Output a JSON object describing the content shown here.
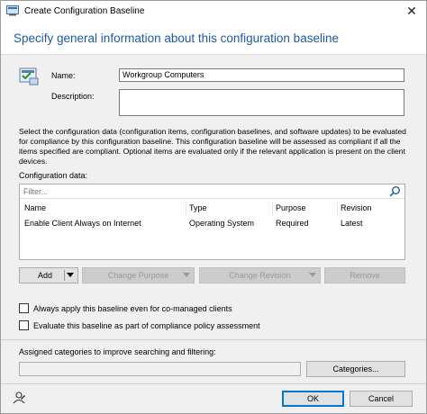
{
  "window": {
    "title": "Create Configuration Baseline",
    "close_glyph": "✕"
  },
  "header": {
    "heading": "Specify general information about this configuration baseline"
  },
  "form": {
    "name_label": "Name:",
    "name_value": "Workgroup Computers",
    "description_label": "Description:",
    "description_value": ""
  },
  "info_text": "Select the configuration data (configuration items, configuration baselines, and software updates) to be evaluated for compliance by this configuration baseline. This configuration baseline will be assessed as compliant if all the items specified are compliant. Optional items are evaluated only if the relevant application is present on  the client devices.",
  "config_data": {
    "label": "Configuration data:",
    "filter_placeholder": "Filter...",
    "columns": [
      "Name",
      "Type",
      "Purpose",
      "Revision"
    ],
    "rows": [
      {
        "name": "Enable Client Always on Internet",
        "type": "Operating System",
        "purpose": "Required",
        "revision": "Latest"
      }
    ]
  },
  "actions": {
    "add": "Add",
    "change_purpose": "Change Purpose",
    "change_revision": "Change Revision",
    "remove": "Remove"
  },
  "options": {
    "co_managed": "Always apply this baseline even for co-managed clients",
    "compliance_policy": "Evaluate this baseline as part of compliance policy assessment"
  },
  "categories": {
    "label": "Assigned categories to improve searching and filtering:",
    "value": "",
    "button": "Categories..."
  },
  "footer": {
    "ok": "OK",
    "cancel": "Cancel"
  },
  "colors": {
    "heading_blue": "#1e5aa8",
    "ok_border": "#0078d7"
  },
  "icons": [
    "app-icon",
    "close-icon",
    "wizard-icon",
    "search-icon",
    "chevron-down-icon",
    "feedback-icon"
  ]
}
